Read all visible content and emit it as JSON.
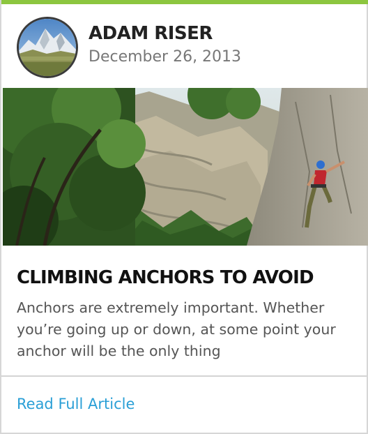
{
  "accent_color": "#8cc63f",
  "link_color": "#2a9fd6",
  "author": {
    "name": "ADAM RISER",
    "date": "December 26, 2013",
    "avatar_icon": "mountain-avatar"
  },
  "hero_image": {
    "subject": "rock climber on cliff face"
  },
  "article": {
    "title": "CLIMBING ANCHORS TO AVOID",
    "excerpt": "Anchors are extremely important. Whether you’re going up or down, at some point your anchor will be the only thing"
  },
  "footer": {
    "link_label": "Read Full Article"
  }
}
